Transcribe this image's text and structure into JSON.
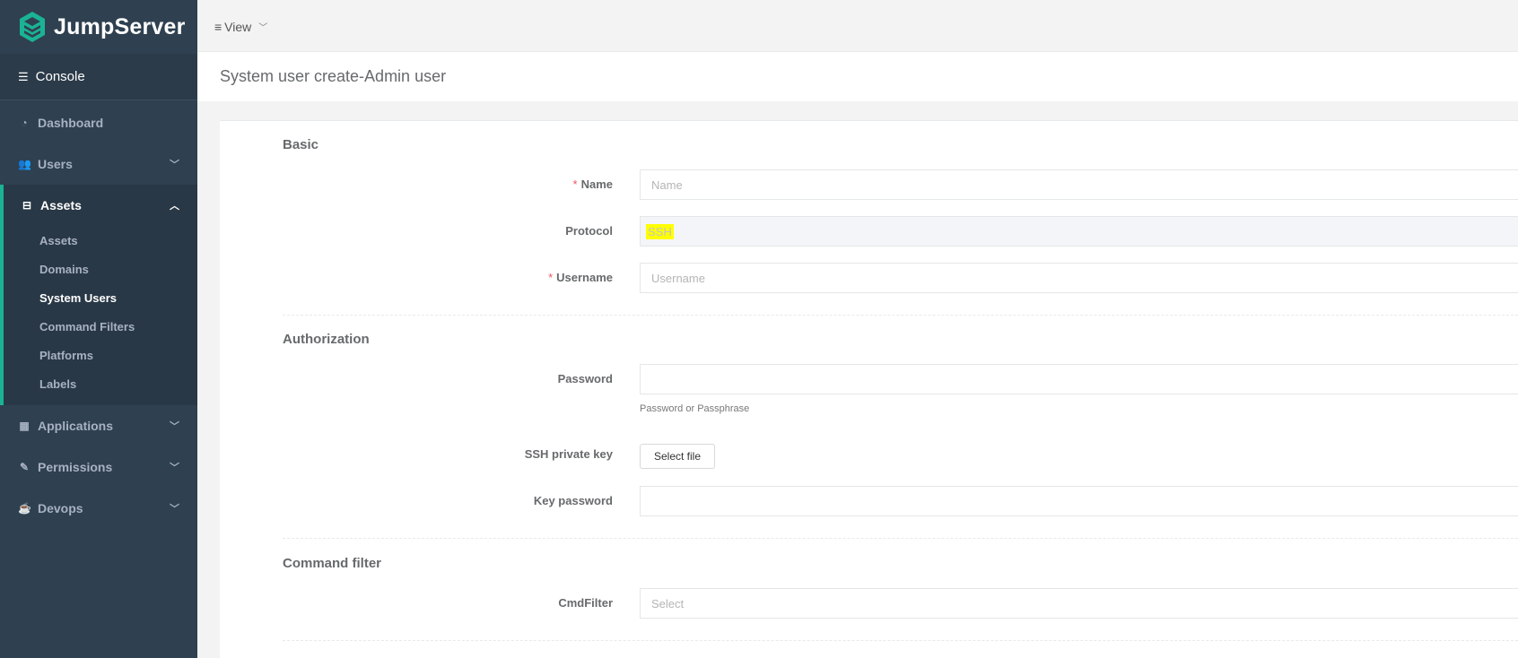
{
  "brand": {
    "name": "JumpServer"
  },
  "sidebar": {
    "console_label": "Console",
    "items": [
      {
        "label": "Dashboard",
        "icon": "dashboard-icon"
      },
      {
        "label": "Users",
        "icon": "users-icon"
      },
      {
        "label": "Assets",
        "icon": "inbox-icon",
        "expanded": true,
        "children": [
          "Assets",
          "Domains",
          "System Users",
          "Command Filters",
          "Platforms",
          "Labels"
        ],
        "active_child": "System Users"
      },
      {
        "label": "Applications",
        "icon": "grid-icon"
      },
      {
        "label": "Permissions",
        "icon": "edit-icon"
      },
      {
        "label": "Devops",
        "icon": "coffee-icon"
      }
    ]
  },
  "topbar": {
    "view_label": "View"
  },
  "page": {
    "title": "System user create-Admin user"
  },
  "form": {
    "basic": {
      "title": "Basic",
      "name_label": "Name",
      "name_placeholder": "Name",
      "protocol_label": "Protocol",
      "protocol_value": "SSH",
      "username_label": "Username",
      "username_placeholder": "Username"
    },
    "auth": {
      "title": "Authorization",
      "password_label": "Password",
      "password_help": "Password or Passphrase",
      "ssh_key_label": "SSH private key",
      "select_file_label": "Select file",
      "key_password_label": "Key password"
    },
    "cmd": {
      "title": "Command filter",
      "cmdfilter_label": "CmdFilter",
      "cmdfilter_placeholder": "Select"
    },
    "required_mark": "*"
  },
  "colors": {
    "sidebar_bg": "#2f4050",
    "accent": "#1ab394",
    "highlight": "#ffff00",
    "required": "#ed5565"
  }
}
